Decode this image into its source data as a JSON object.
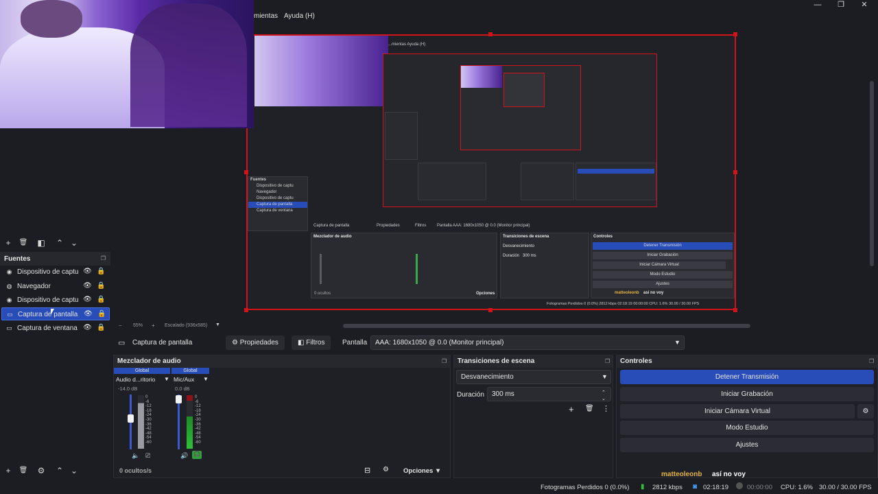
{
  "window": {
    "minimize_glyph": "—",
    "maximize_glyph": "❐",
    "close_glyph": "✕"
  },
  "menu": {
    "tools_partial": "mientas",
    "help": "Ayuda (H)"
  },
  "preview": {
    "zoom_level": "55%",
    "zoom_minus": "−",
    "zoom_plus": "+",
    "scaling": "Escalado (936x585)",
    "nested_menu_text": "...mientas  Ayuda (H)",
    "nested_sources_title": "Fuentes",
    "nested_sources": [
      "Dispositivo de captu",
      "Navegador",
      "Dispositivo de captu",
      "Captura de pantalla",
      "Captura de ventana"
    ],
    "nested_capture": "Captura de pantalla",
    "nested_props": "Propiedades",
    "nested_filters": "Filtros",
    "nested_display": "Pantalla  AAA: 1680x1050 @ 0.0 (Monitor principal)",
    "nested_mixer": "Mezclador de audio",
    "nested_transitions": "Transiciones de escena",
    "nested_controls": "Controles",
    "nested_fade": "Desvanecimiento",
    "nested_duration": "Duración",
    "nested_duration_val": "300 ms",
    "nested_buttons": [
      "Detener Transmisión",
      "Iniciar Grabación",
      "Iniciar Cámara Virtual",
      "Modo Estudio",
      "Ajustes"
    ],
    "nested_hidden": "0 ocultos",
    "nested_options": "Opciones",
    "nested_user": "matteoleonb",
    "nested_user_msg": "así no voy",
    "nested_status": "Fotogramas Perdidos 0 (0.0%)   2812 kbps   02:18:19   00:00:00   CPU: 1.6%   30.00 / 30.00 FPS"
  },
  "scenes_toolbar": [
    "+",
    "🗑",
    "◧",
    "⌃",
    "⌄"
  ],
  "sources": {
    "title": "Fuentes",
    "items": [
      {
        "label": "Dispositivo de captu",
        "icon": "camera-icon",
        "glyph": "◉",
        "selected": false
      },
      {
        "label": "Navegador",
        "icon": "globe-icon",
        "glyph": "◍",
        "selected": false
      },
      {
        "label": "Dispositivo de captu",
        "icon": "camera-icon",
        "glyph": "◉",
        "selected": false
      },
      {
        "label": "Captura de pantalla",
        "icon": "monitor-icon",
        "glyph": "▭",
        "selected": true
      },
      {
        "label": "Captura de ventana",
        "icon": "window-icon",
        "glyph": "▭",
        "selected": false
      }
    ],
    "toolbar": [
      "+",
      "🗑",
      "⚙",
      "⌃",
      "⌄"
    ]
  },
  "source_bar": {
    "selected_source": "Captura de pantalla",
    "properties": "Propiedades",
    "filters": "Filtros",
    "display_label": "Pantalla",
    "display_value": "AAA: 1680x1050 @ 0.0 (Monitor principal)"
  },
  "mixer": {
    "title": "Mezclador de audio",
    "channels": [
      {
        "tag": "Global",
        "name": "Audio d...ritorio",
        "db": "-14.0 dB",
        "level": 0.62,
        "muted": true
      },
      {
        "tag": "Global",
        "name": "Mic/Aux",
        "db": "0.0 dB",
        "level": 0.92,
        "muted": false
      }
    ],
    "scale": [
      "0",
      "-6",
      "-12",
      "-18",
      "-24",
      "-30",
      "-36",
      "-42",
      "-48",
      "-54",
      "-60"
    ],
    "hidden": "0 ocultos/s",
    "options": "Opciones"
  },
  "transitions": {
    "title": "Transiciones de escena",
    "selected": "Desvanecimiento",
    "duration_label": "Duración",
    "duration_value": "300 ms"
  },
  "controls": {
    "title": "Controles",
    "stop_stream": "Detener Transmisión",
    "start_recording": "Iniciar Grabación",
    "start_virtualcam": "Iniciar Cámara Virtual",
    "studio_mode": "Modo Estudio",
    "settings": "Ajustes"
  },
  "chat": {
    "user": "matteoleonb",
    "message": "así no voy"
  },
  "status": {
    "dropped_frames": "Fotogramas Perdidos 0 (0.0%)",
    "bitrate": "2812 kbps",
    "stream_time": "02:18:19",
    "record_time": "00:00:00",
    "cpu": "CPU: 1.6%",
    "fps": "30.00 / 30.00 FPS"
  },
  "colors": {
    "accent": "#284cb8",
    "preview_border": "#d1141a",
    "background": "#1c1d22"
  }
}
